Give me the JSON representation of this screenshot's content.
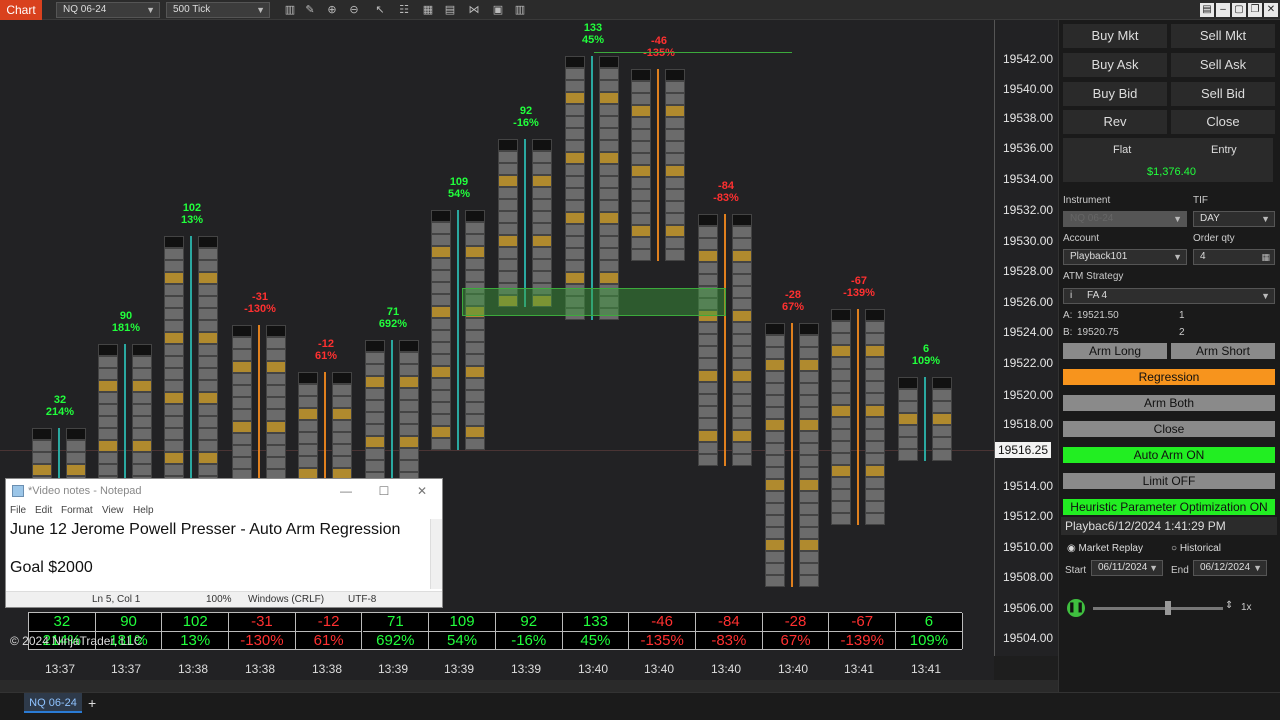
{
  "toolbar": {
    "chart_tab": "Chart",
    "instrument": "NQ 06-24",
    "interval": "500 Tick"
  },
  "price_axis": {
    "labels": [
      "19542.00",
      "19540.00",
      "19538.00",
      "19536.00",
      "19534.00",
      "19532.00",
      "19530.00",
      "19528.00",
      "19526.00",
      "19524.00",
      "19522.00",
      "19520.00",
      "19518.00",
      "19514.00",
      "19512.00",
      "19510.00",
      "19508.00",
      "19506.00",
      "19504.00"
    ],
    "current": "19516.25"
  },
  "bars": [
    {
      "head_vol": "32",
      "head_pct": "214%",
      "color": "pos"
    },
    {
      "head_vol": "90",
      "head_pct": "181%",
      "color": "pos"
    },
    {
      "head_vol": "102",
      "head_pct": "13%",
      "color": "pos"
    },
    {
      "head_vol": "-31",
      "head_pct": "-130%",
      "color": "neg"
    },
    {
      "head_vol": "-12",
      "head_pct": "61%",
      "color": "neg"
    },
    {
      "head_vol": "71",
      "head_pct": "692%",
      "color": "pos"
    },
    {
      "head_vol": "109",
      "head_pct": "54%",
      "color": "pos"
    },
    {
      "head_vol": "92",
      "head_pct": "-16%",
      "color": "pos"
    },
    {
      "head_vol": "133",
      "head_pct": "45%",
      "color": "pos"
    },
    {
      "head_vol": "-46",
      "head_pct": "-135%",
      "color": "neg"
    },
    {
      "head_vol": "-84",
      "head_pct": "-83%",
      "color": "neg"
    },
    {
      "head_vol": "-28",
      "head_pct": "67%",
      "color": "neg"
    },
    {
      "head_vol": "-67",
      "head_pct": "-139%",
      "color": "neg"
    },
    {
      "head_vol": "6",
      "head_pct": "109%",
      "color": "pos"
    }
  ],
  "summary": {
    "row1": [
      "32",
      "90",
      "102",
      "-31",
      "-12",
      "71",
      "109",
      "92",
      "133",
      "-46",
      "-84",
      "-28",
      "-67",
      "6"
    ],
    "row2": [
      "214%",
      "181%",
      "13%",
      "-130%",
      "61%",
      "692%",
      "54%",
      "-16%",
      "45%",
      "-135%",
      "-83%",
      "67%",
      "-139%",
      "109%"
    ]
  },
  "time_axis": [
    "13:37",
    "13:37",
    "13:38",
    "13:38",
    "13:38",
    "13:39",
    "13:39",
    "13:39",
    "13:40",
    "13:40",
    "13:40",
    "13:40",
    "13:41",
    "13:41"
  ],
  "copyright": "© 2024 NinjaTrader, LLC",
  "bottom_tab": "NQ 06-24",
  "notepad": {
    "title": "*Video notes - Notepad",
    "menu": [
      "File",
      "Edit",
      "Format",
      "View",
      "Help"
    ],
    "line1": "June 12 Jerome Powell Presser - Auto Arm Regression",
    "line2": "Goal $2000",
    "status": {
      "pos": "Ln 5, Col 1",
      "zoom": "100%",
      "eol": "Windows (CRLF)",
      "enc": "UTF-8"
    }
  },
  "panel": {
    "buy_mkt": "Buy Mkt",
    "sell_mkt": "Sell Mkt",
    "buy_ask": "Buy Ask",
    "sell_ask": "Sell Ask",
    "buy_bid": "Buy Bid",
    "sell_bid": "Sell Bid",
    "rev": "Rev",
    "close": "Close",
    "flat": "Flat",
    "entry": "Entry",
    "pnl": "$1,376.40",
    "instrument_label": "Instrument",
    "instrument": "NQ 06-24",
    "tif_label": "TIF",
    "tif": "DAY",
    "account_label": "Account",
    "account": "Playback101",
    "order_qty_label": "Order qty",
    "order_qty": "4",
    "atm_label": "ATM Strategy",
    "atm_info": "i",
    "atm": "FA 4",
    "a_label": "A:",
    "a_price": "19521.50",
    "a_qty": "1",
    "b_label": "B:",
    "b_price": "19520.75",
    "b_qty": "2",
    "arm_long": "Arm Long",
    "arm_short": "Arm Short",
    "regression": "Regression",
    "arm_both": "Arm Both",
    "close2": "Close",
    "auto_arm": "Auto Arm ON",
    "limit": "Limit OFF",
    "heuristic": "Heuristic Parameter Optimization ON",
    "playback": "Playbac",
    "playback_time": "6/12/2024 1:41:29 PM",
    "market_replay": "Market Replay",
    "historical": "Historical",
    "start_label": "Start",
    "start": "06/11/2024",
    "end_label": "End",
    "end": "06/12/2024",
    "speed": "1x"
  },
  "colors": {
    "positive": "#21ff3c",
    "negative": "#ff3030",
    "regression": "#f7941d",
    "auto_arm": "#22ee22",
    "heuristic": "#22ee22",
    "chart_tab": "#d9411e"
  }
}
